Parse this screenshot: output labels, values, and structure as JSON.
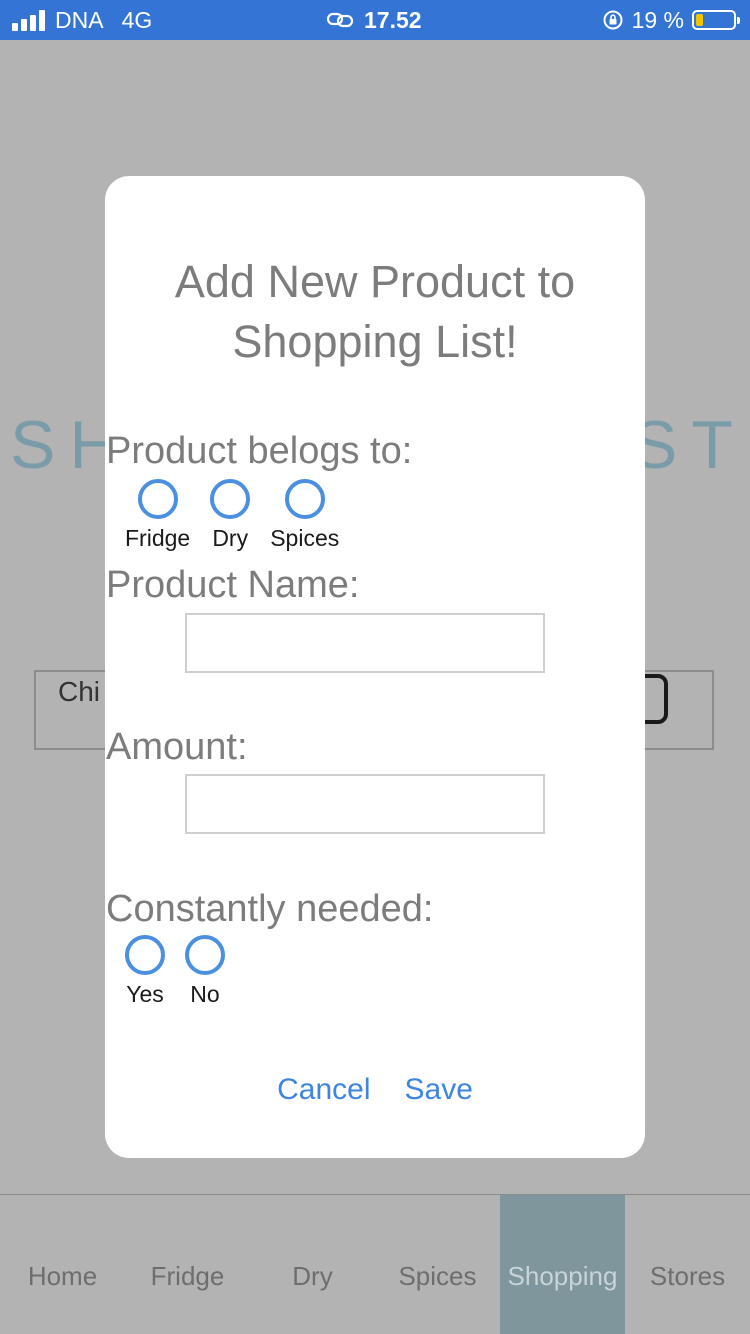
{
  "status_bar": {
    "carrier": "DNA",
    "network": "4G",
    "time": "17.52",
    "battery_percent": "19 %",
    "battery_level": 0.19,
    "icons": [
      "signal-icon",
      "link-icon",
      "rotation-lock-icon",
      "battery-icon"
    ]
  },
  "background": {
    "title_left": "SH",
    "title_right": "ST",
    "list_item_partial": "Chi"
  },
  "modal": {
    "title": "Add New Product to Shopping List!",
    "category_label": "Product belogs to:",
    "category_options": [
      "Fridge",
      "Dry",
      "Spices"
    ],
    "name_label": "Product Name:",
    "name_value": "",
    "amount_label": "Amount:",
    "amount_value": "",
    "constant_label": "Constantly needed:",
    "constant_options": [
      "Yes",
      "No"
    ],
    "cancel_label": "Cancel",
    "save_label": "Save"
  },
  "tabbar": {
    "tabs": [
      "Home",
      "Fridge",
      "Dry",
      "Spices",
      "Shopping",
      "Stores"
    ],
    "active": "Shopping"
  },
  "colors": {
    "status_bar": "#3474d4",
    "overlay": "#b3b3b3",
    "accent": "#3e85dd",
    "radio": "#4a8fe0",
    "active_tab": "#7e969c"
  }
}
